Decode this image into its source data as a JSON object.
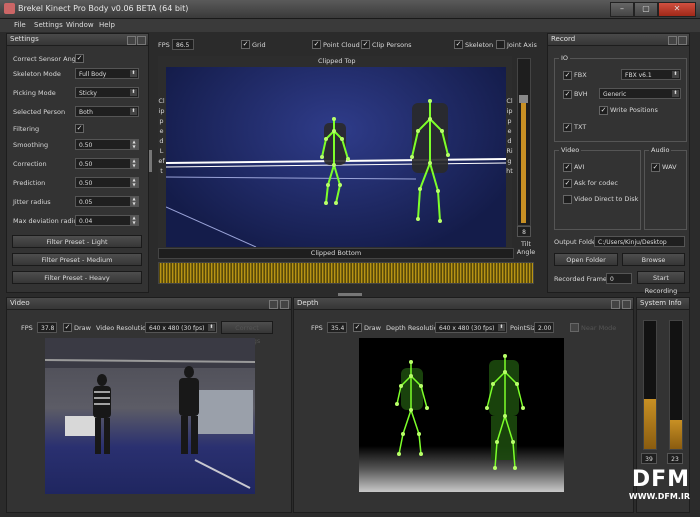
{
  "window": {
    "title": "Brekel Kinect Pro Body v0.06 BETA (64 bit)",
    "min": "–",
    "max": "▢",
    "close": "✕"
  },
  "menu": [
    "File",
    "Settings",
    "Window",
    "Help"
  ],
  "settings": {
    "title": "Settings",
    "correct_sensor_angle": "Correct Sensor Angle",
    "skeleton_mode_label": "Skeleton Mode",
    "skeleton_mode": "Full Body",
    "picking_mode_label": "Picking Mode",
    "picking_mode": "Sticky",
    "selected_person_label": "Selected Person",
    "selected_person": "Both",
    "filtering": "Filtering",
    "smoothing_label": "Smoothing",
    "smoothing": "0.50",
    "correction_label": "Correction",
    "correction": "0.50",
    "prediction_label": "Prediction",
    "prediction": "0.50",
    "jitter_label": "Jitter radius",
    "jitter": "0.05",
    "maxdev_label": "Max deviation radius",
    "maxdev": "0.04",
    "preset_light": "Filter Preset - Light",
    "preset_medium": "Filter Preset - Medium",
    "preset_heavy": "Filter Preset - Heavy"
  },
  "viewport": {
    "fps_label": "FPS",
    "fps": "86.5",
    "grid": "Grid",
    "point_cloud": "Point Cloud",
    "clip_persons": "Clip Persons",
    "skeleton": "Skeleton",
    "joint_axis": "Joint Axis",
    "clipped_top": "Clipped Top",
    "clipped_bottom": "Clipped Bottom",
    "clipped_left": "Clipped Left",
    "clipped_right": "Clipped Right",
    "tilt_value": "8",
    "tilt_label": "Tilt Angle"
  },
  "record": {
    "title": "Record",
    "io_group": "IO",
    "fbx": "FBX",
    "fbx_version": "FBX v6.1",
    "bvh": "BVH",
    "bvh_mode": "Generic",
    "write_positions": "Write Positions",
    "txt": "TXT",
    "video_group": "Video",
    "avi": "AVI",
    "ask_codec": "Ask for codec",
    "video_direct": "Video Direct to Disk",
    "audio_group": "Audio",
    "wav": "WAV",
    "output_folder_label": "Output Folder",
    "output_folder": "C:/Users/Kinju/Desktop",
    "open_folder": "Open Folder",
    "browse": "Browse",
    "recorded_frames_label": "Recorded Frames",
    "recorded_frames": "0",
    "start_recording": "Start Recording"
  },
  "video": {
    "title": "Video",
    "fps_label": "FPS",
    "fps": "37.8",
    "draw": "Draw",
    "res_label": "Video Resolution",
    "resolution": "640 x 480 (30 fps)",
    "correct_settings": "Correct Settings"
  },
  "depth": {
    "title": "Depth",
    "fps_label": "FPS",
    "fps": "35.4",
    "draw": "Draw",
    "res_label": "Depth Resolution",
    "resolution": "640 x 480 (30 fps)",
    "pointsize_label": "PointSize",
    "pointsize": "2.00",
    "near_mode": "Near Mode"
  },
  "sysinfo": {
    "title": "System Info",
    "bar1_value": "39",
    "bar2_value": "23",
    "bar1_level": 0.39,
    "bar2_level": 0.23
  },
  "watermark": {
    "brand": "DFM",
    "url": "WWW.DFM.IR"
  },
  "colors": {
    "accent": "#c89024",
    "skeleton": "#7dff2a",
    "scene": "#1f2a6a"
  }
}
